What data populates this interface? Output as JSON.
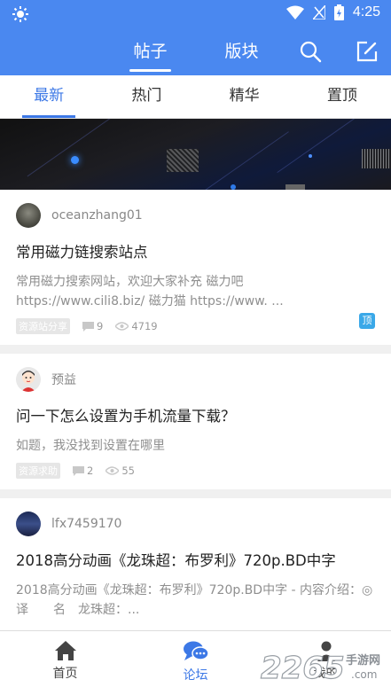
{
  "status_bar": {
    "time": "4:25"
  },
  "top_nav": {
    "tabs": [
      {
        "label": "帖子",
        "active": true
      },
      {
        "label": "版块",
        "active": false
      }
    ]
  },
  "sub_tabs": [
    {
      "label": "最新",
      "active": true
    },
    {
      "label": "热门"
    },
    {
      "label": "精华"
    },
    {
      "label": "置顶"
    }
  ],
  "posts": [
    {
      "author": "oceanzhang01",
      "title": "常用磁力链搜索站点",
      "excerpt": "常用磁力搜索网站，欢迎大家补充 磁力吧 https://www.cili8.biz/ 磁力猫 https://www. ...",
      "tag": "资源站分享",
      "comments": "9",
      "views": "4719",
      "pin_label": "顶"
    },
    {
      "author": "预益",
      "title": "问一下怎么设置为手机流量下载？",
      "excerpt": "如题，我没找到设置在哪里",
      "tag": "资源求助",
      "comments": "2",
      "views": "55"
    },
    {
      "author": "lfx7459170",
      "title": "2018高分动画《龙珠超：布罗利》720p.BD中字",
      "excerpt": "2018高分动画《龙珠超：布罗利》720p.BD中字 - 内容介绍：◎译　　名　龙珠超：..."
    }
  ],
  "bottom_nav": [
    {
      "label": "首页",
      "icon": "home-icon"
    },
    {
      "label": "论坛",
      "icon": "forum-icon",
      "active": true
    },
    {
      "label": "我的",
      "icon": "profile-icon"
    }
  ],
  "watermark": {
    "brand": "2265",
    "text": "手游网",
    "url": ".com"
  },
  "colors": {
    "primary": "#4a88f0",
    "accent": "#3c78e6",
    "pin": "#3aa8e8"
  }
}
